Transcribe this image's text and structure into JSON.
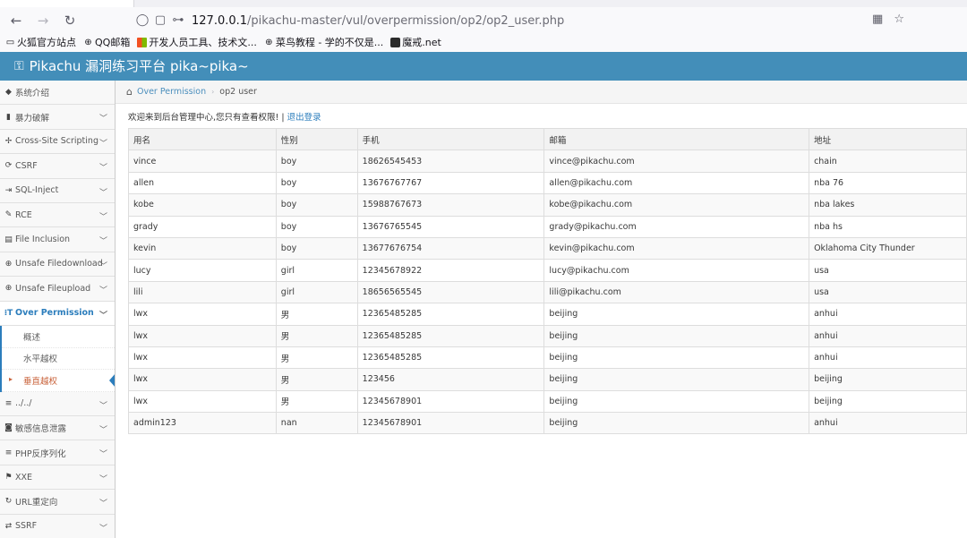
{
  "browser": {
    "url_host": "127.0.0.1",
    "url_path": "/pikachu-master/vul/overpermission/op2/op2_user.php",
    "bookmarks": [
      {
        "label": "火狐官方站点",
        "icon": "folder-icon"
      },
      {
        "label": "QQ邮箱",
        "icon": "globe-icon"
      },
      {
        "label": "开发人员工具、技术文...",
        "icon": "grid-icon"
      },
      {
        "label": "菜鸟教程 - 学的不仅是...",
        "icon": "globe-icon"
      },
      {
        "label": "魔戒.net",
        "icon": "dark-square-icon"
      }
    ]
  },
  "app": {
    "title": "Pikachu 漏洞练习平台 pika~pika~"
  },
  "sidebar": {
    "items": [
      {
        "label": "系统介绍",
        "icon": "◆",
        "chevron": false
      },
      {
        "label": "暴力破解",
        "icon": "▮",
        "chevron": true
      },
      {
        "label": "Cross-Site Scripting",
        "icon": "✢",
        "chevron": true
      },
      {
        "label": "CSRF",
        "icon": "⟳",
        "chevron": true
      },
      {
        "label": "SQL-Inject",
        "icon": "⇥",
        "chevron": true
      },
      {
        "label": "RCE",
        "icon": "✎",
        "chevron": true
      },
      {
        "label": "File Inclusion",
        "icon": "▤",
        "chevron": true
      },
      {
        "label": "Unsafe Filedownload",
        "icon": "⊕",
        "chevron": true
      },
      {
        "label": "Unsafe Fileupload",
        "icon": "⊕",
        "chevron": true
      },
      {
        "label": "Over Permission",
        "icon": "⁝T",
        "chevron": true,
        "active": true
      },
      {
        "label": "../../",
        "icon": "≡",
        "chevron": true
      },
      {
        "label": "敏感信息泄露",
        "icon": "◙",
        "chevron": true
      },
      {
        "label": "PHP反序列化",
        "icon": "≡",
        "chevron": true
      },
      {
        "label": "XXE",
        "icon": "⚑",
        "chevron": true
      },
      {
        "label": "URL重定向",
        "icon": "↻",
        "chevron": true
      },
      {
        "label": "SSRF",
        "icon": "⇄",
        "chevron": true
      }
    ],
    "submenu": [
      {
        "label": "概述"
      },
      {
        "label": "水平越权"
      },
      {
        "label": "垂直越权",
        "current": true
      }
    ]
  },
  "breadcrumb": {
    "link": "Over Permission",
    "separator": "›",
    "current": "op2 user"
  },
  "welcome": {
    "text": "欢迎来到后台管理中心,您只有查看权限! | ",
    "logout": "退出登录"
  },
  "table": {
    "headers": [
      "用名",
      "性别",
      "手机",
      "邮箱",
      "地址"
    ],
    "rows": [
      [
        "vince",
        "boy",
        "18626545453",
        "vince@pikachu.com",
        "chain"
      ],
      [
        "allen",
        "boy",
        "13676767767",
        "allen@pikachu.com",
        "nba 76"
      ],
      [
        "kobe",
        "boy",
        "15988767673",
        "kobe@pikachu.com",
        "nba lakes"
      ],
      [
        "grady",
        "boy",
        "13676765545",
        "grady@pikachu.com",
        "nba hs"
      ],
      [
        "kevin",
        "boy",
        "13677676754",
        "kevin@pikachu.com",
        "Oklahoma City Thunder"
      ],
      [
        "lucy",
        "girl",
        "12345678922",
        "lucy@pikachu.com",
        "usa"
      ],
      [
        "lili",
        "girl",
        "18656565545",
        "lili@pikachu.com",
        "usa"
      ],
      [
        "lwx",
        "男",
        "12365485285",
        "beijing",
        "anhui"
      ],
      [
        "lwx",
        "男",
        "12365485285",
        "beijing",
        "anhui"
      ],
      [
        "lwx",
        "男",
        "12365485285",
        "beijing",
        "anhui"
      ],
      [
        "lwx",
        "男",
        "123456",
        "beijing",
        "beijing"
      ],
      [
        "lwx",
        "男",
        "12345678901",
        "beijing",
        "beijing"
      ],
      [
        "admin123",
        "nan",
        "12345678901",
        "beijing",
        "anhui"
      ]
    ]
  },
  "colors": {
    "header_bg": "#438eb9",
    "active_blue": "#2b7dbc",
    "current_sub": "#c86139"
  }
}
